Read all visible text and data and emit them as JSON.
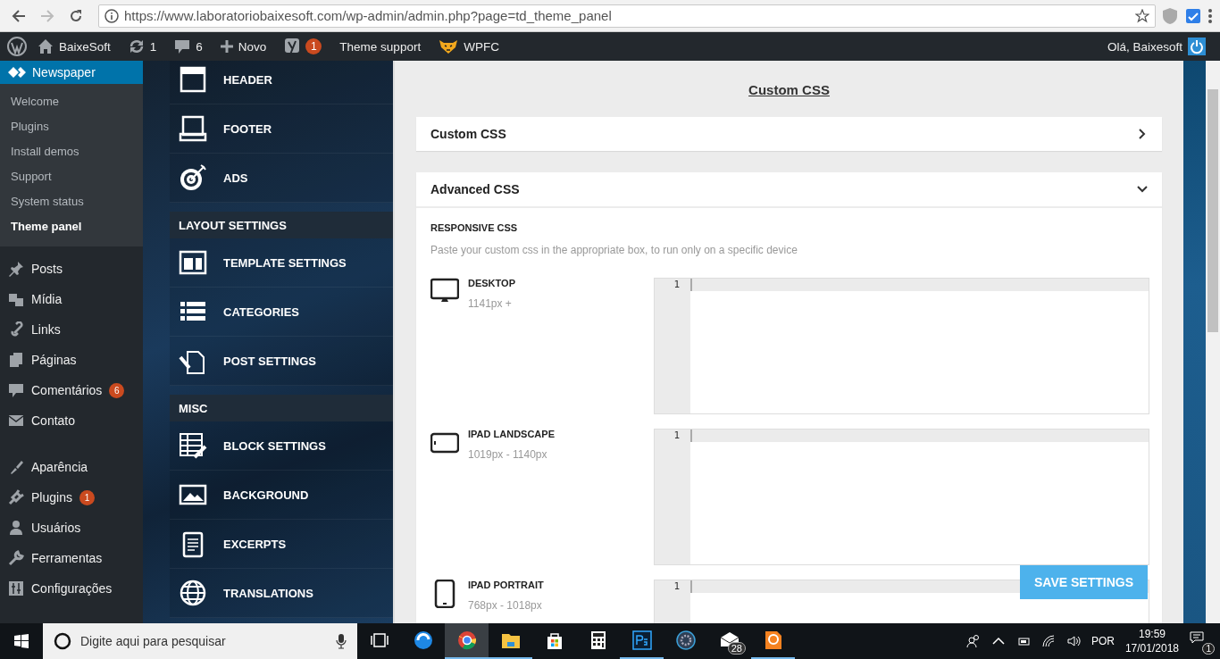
{
  "browser": {
    "url": "https://www.laboratoriobaixesoft.com/wp-admin/admin.php?page=td_theme_panel"
  },
  "admin_bar": {
    "site": "BaixeSoft",
    "updates": "1",
    "comments": "6",
    "new": "Novo",
    "seo_badge": "1",
    "theme_support": "Theme support",
    "cache": "WPFC",
    "greeting": "Olá, Baixesoft"
  },
  "sidebar": {
    "current": "Newspaper",
    "submenu": [
      {
        "label": "Welcome",
        "selected": false
      },
      {
        "label": "Plugins",
        "selected": false
      },
      {
        "label": "Install demos",
        "selected": false
      },
      {
        "label": "Support",
        "selected": false
      },
      {
        "label": "System status",
        "selected": false
      },
      {
        "label": "Theme panel",
        "selected": true
      }
    ],
    "groups": [
      [
        {
          "label": "Posts"
        },
        {
          "label": "Mídia"
        },
        {
          "label": "Links"
        },
        {
          "label": "Páginas"
        },
        {
          "label": "Comentários",
          "badge": "6"
        },
        {
          "label": "Contato"
        }
      ],
      [
        {
          "label": "Aparência"
        },
        {
          "label": "Plugins",
          "badge": "1"
        },
        {
          "label": "Usuários"
        },
        {
          "label": "Ferramentas"
        },
        {
          "label": "Configurações"
        }
      ]
    ]
  },
  "theme_nav": [
    {
      "kind": "item",
      "label": "HEADER"
    },
    {
      "kind": "item",
      "label": "FOOTER"
    },
    {
      "kind": "item",
      "label": "ADS"
    },
    {
      "kind": "heading",
      "label": "LAYOUT SETTINGS"
    },
    {
      "kind": "item",
      "label": "TEMPLATE SETTINGS"
    },
    {
      "kind": "item",
      "label": "CATEGORIES"
    },
    {
      "kind": "item",
      "label": "POST SETTINGS"
    },
    {
      "kind": "heading",
      "label": "MISC"
    },
    {
      "kind": "item",
      "label": "BLOCK SETTINGS"
    },
    {
      "kind": "item",
      "label": "BACKGROUND"
    },
    {
      "kind": "item",
      "label": "EXCERPTS"
    },
    {
      "kind": "item",
      "label": "TRANSLATIONS"
    }
  ],
  "content": {
    "title": "Custom CSS",
    "panels": [
      {
        "title": "Custom CSS",
        "expanded": false
      },
      {
        "title": "Advanced CSS",
        "expanded": true,
        "section": "RESPONSIVE CSS",
        "hint": "Paste your custom css in the appropriate box, to run only on a specific device",
        "devices": [
          {
            "kind": "desktop",
            "name": "DESKTOP",
            "range": "1141px +",
            "line": "1"
          },
          {
            "kind": "landscape",
            "name": "IPAD LANDSCAPE",
            "range": "1019px - 1140px",
            "line": "1"
          },
          {
            "kind": "portrait",
            "name": "IPAD PORTRAIT",
            "range": "768px - 1018px",
            "line": "1"
          }
        ]
      }
    ],
    "save": "SAVE SETTINGS"
  },
  "taskbar": {
    "search": {
      "placeholder": "Digite aqui para pesquisar"
    },
    "apps": [
      {
        "running": false,
        "selected": false
      },
      {
        "running": false,
        "selected": false
      },
      {
        "running": true,
        "selected": true
      },
      {
        "running": true,
        "selected": false
      },
      {
        "running": false,
        "selected": false
      },
      {
        "running": false,
        "selected": false
      },
      {
        "running": true,
        "selected": false
      },
      {
        "running": false,
        "selected": false
      },
      {
        "running": false,
        "selected": false,
        "badge": "28"
      },
      {
        "running": true,
        "selected": false
      }
    ],
    "language": "POR",
    "time": "19:59",
    "date": "17/01/2018",
    "notifications": "1"
  }
}
